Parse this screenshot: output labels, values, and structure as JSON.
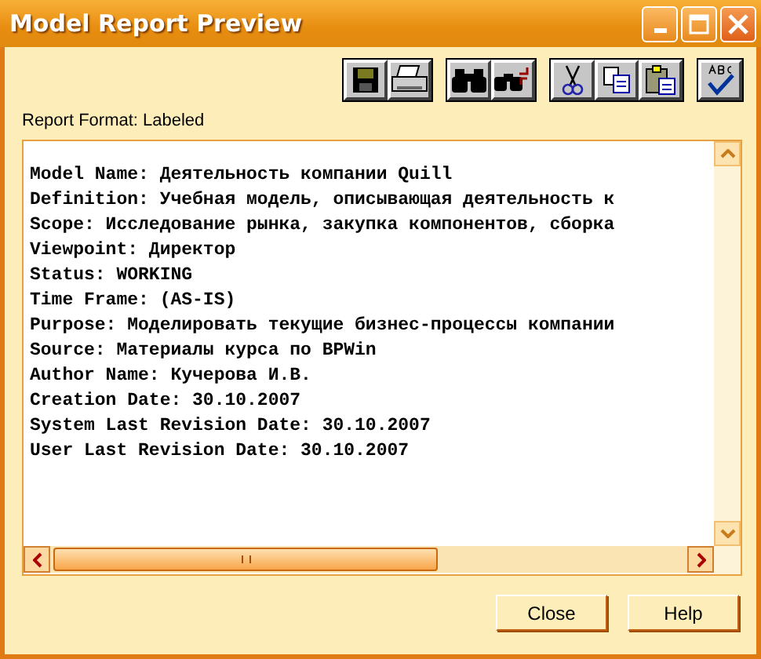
{
  "window": {
    "title": "Model Report Preview"
  },
  "report_format": "Report Format: Labeled",
  "report_lines": [
    "Model Name: Деятельность компании Quill",
    "Definition: Учебная модель, описывающая деятельность к",
    "Scope: Исследование рынка, закупка компонентов, сборка",
    "Viewpoint: Директор",
    "Status: WORKING",
    "Time Frame: (AS-IS)",
    "Purpose: Моделировать текущие бизнес-процессы компании",
    "Source: Материалы курса по BPWin",
    "Author Name: Кучерова И.В.",
    "Creation Date: 30.10.2007",
    "System Last Revision Date: 30.10.2007",
    "User Last Revision Date: 30.10.2007"
  ],
  "buttons": [
    "Close",
    "Help"
  ]
}
